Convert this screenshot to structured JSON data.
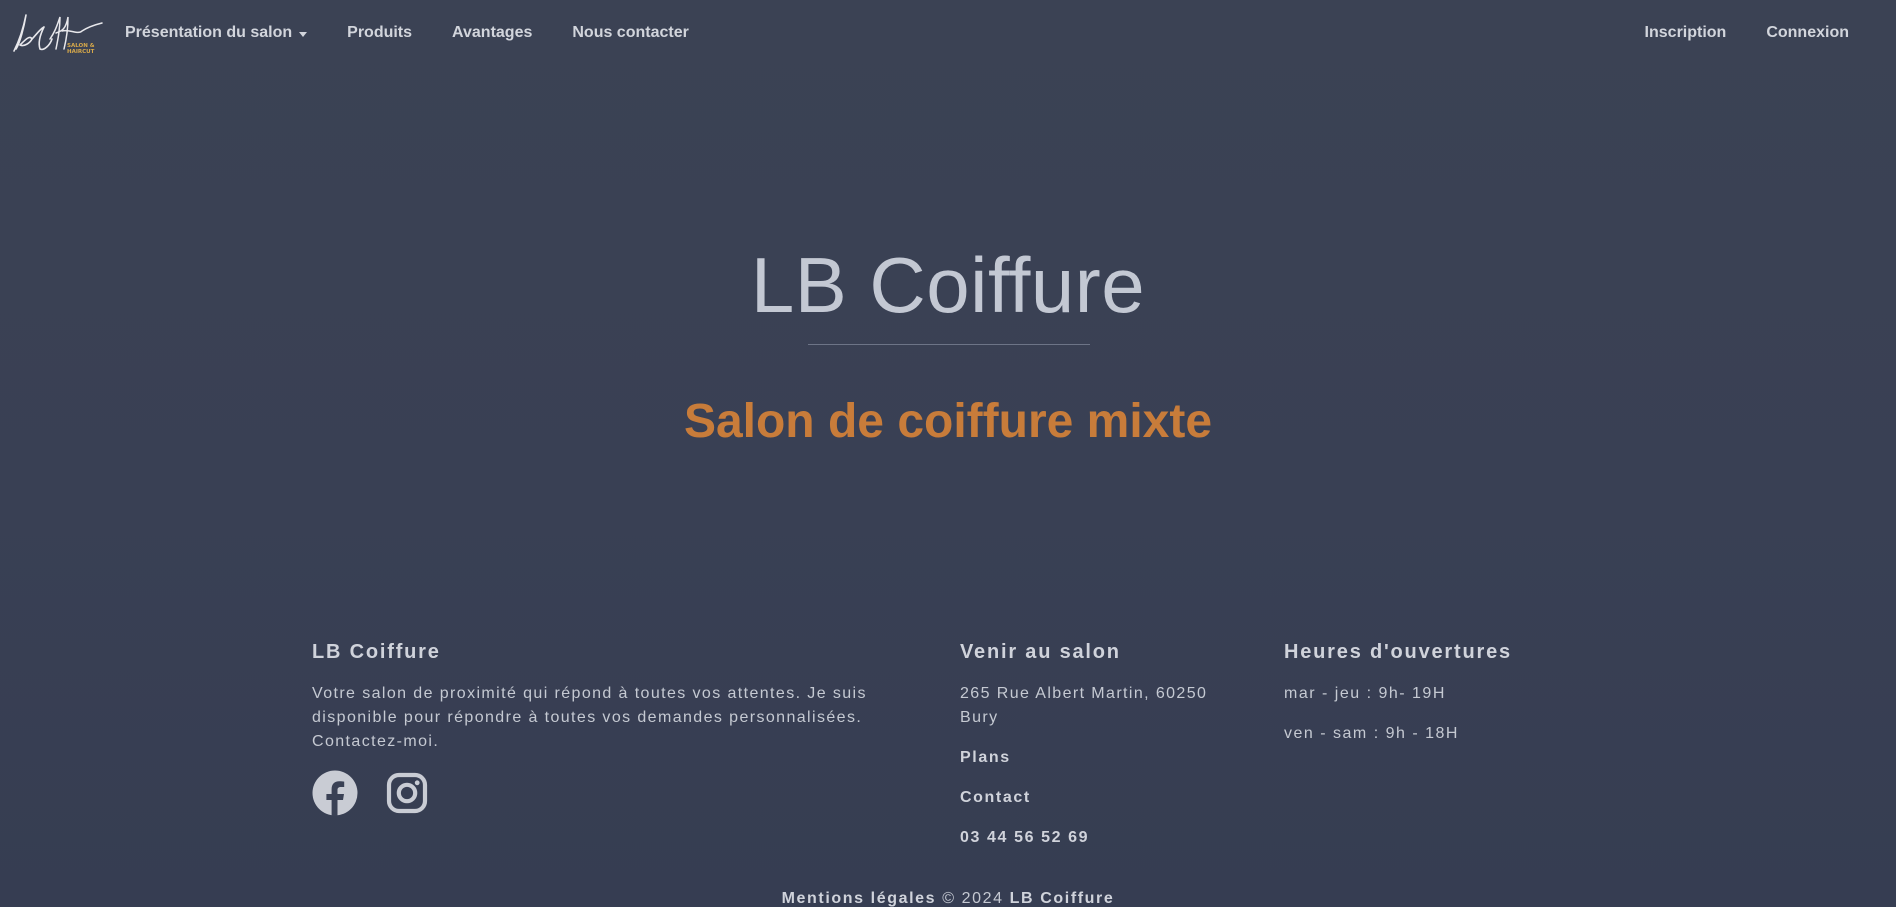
{
  "nav": {
    "logo_text": "LB Coiffure",
    "logo_subtext": "SALON & HAIRCUT",
    "left_items": [
      {
        "label": "Présentation du salon",
        "has_dropdown": true
      },
      {
        "label": "Produits"
      },
      {
        "label": "Avantages"
      },
      {
        "label": "Nous contacter"
      }
    ],
    "right_items": [
      {
        "label": "Inscription"
      },
      {
        "label": "Connexion"
      }
    ]
  },
  "hero": {
    "title": "LB Coiffure",
    "subtitle": "Salon de coiffure mixte"
  },
  "footer": {
    "about": {
      "heading": "LB Coiffure",
      "text": "Votre salon de proximité qui répond à toutes vos attentes. Je suis disponible pour répondre à toutes vos demandes personnalisées. Contactez-moi.",
      "socials": [
        {
          "icon": "facebook-icon"
        },
        {
          "icon": "instagram-icon"
        }
      ]
    },
    "visit": {
      "heading": "Venir au salon",
      "address": "265 Rue Albert Martin, 60250 Bury",
      "plans": "Plans",
      "contact": "Contact",
      "phone": "03 44 56 52 69"
    },
    "hours": {
      "heading": "Heures d'ouvertures",
      "lines": [
        "mar - jeu : 9h- 19H",
        "ven - sam : 9h - 18H"
      ]
    },
    "legal": {
      "link": "Mentions légales",
      "copyright": "© 2024",
      "brand": "LB Coiffure"
    }
  },
  "colors": {
    "background": "#3a4155",
    "accent": "#c87c3a",
    "logo_gold": "#d6a84a"
  }
}
